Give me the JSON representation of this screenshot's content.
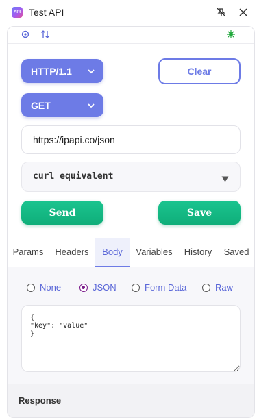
{
  "window": {
    "title": "Test API",
    "app_icon_text": "API"
  },
  "request": {
    "http_version": "HTTP/1.1",
    "method": "GET",
    "url": "https://ipapi.co/json",
    "curl_label": "curl equivalent"
  },
  "buttons": {
    "clear": "Clear",
    "send": "Send",
    "save": "Save"
  },
  "tabs": [
    "Params",
    "Headers",
    "Body",
    "Variables",
    "History",
    "Saved"
  ],
  "active_tab": "Body",
  "body_types": [
    {
      "label": "None",
      "checked": false
    },
    {
      "label": "JSON",
      "checked": true
    },
    {
      "label": "Form Data",
      "checked": false
    },
    {
      "label": "Raw",
      "checked": false
    }
  ],
  "body_content": "{\n\"key\": \"value\"\n}",
  "response": {
    "label": "Response"
  },
  "colors": {
    "accent": "#6d7be6",
    "green": "#10b981",
    "icon_green": "#1fa83a"
  }
}
